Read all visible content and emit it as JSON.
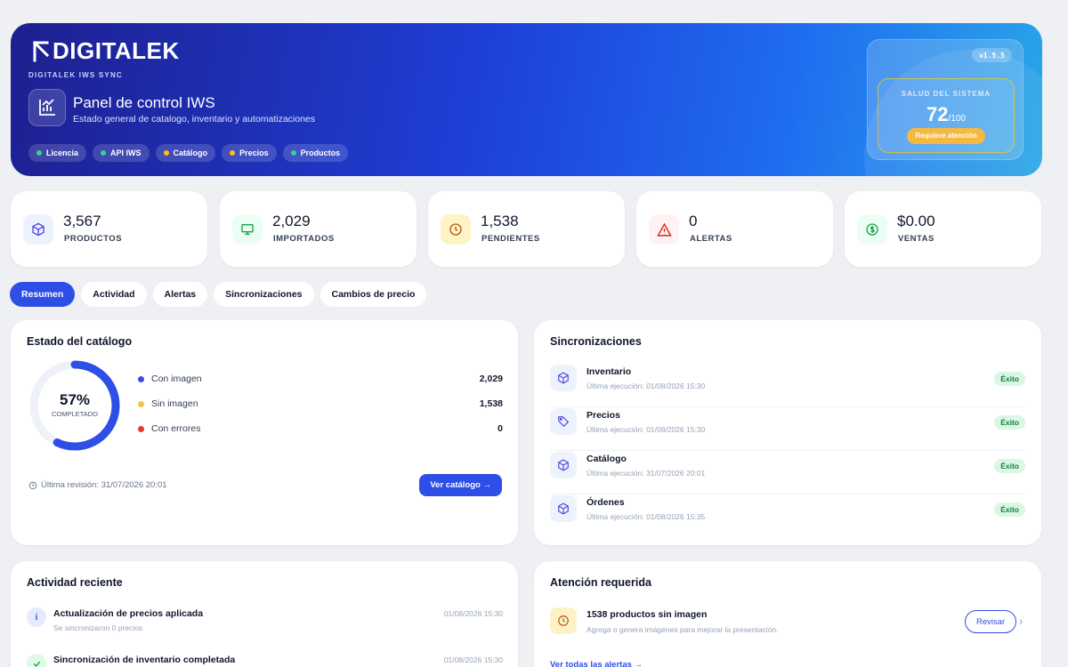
{
  "hero": {
    "logo_text": "DIGITALEK",
    "subtitle_brand": "DIGITALEK IWS SYNC",
    "title": "Panel de control IWS",
    "description": "Estado general de catalogo, inventario y automatizaciones",
    "chips": [
      {
        "label": "Licencia",
        "status_color": "#34d399"
      },
      {
        "label": "API IWS",
        "status_color": "#34d399"
      },
      {
        "label": "Catálogo",
        "status_color": "#fbbf24"
      },
      {
        "label": "Precios",
        "status_color": "#fbbf24"
      },
      {
        "label": "Productos",
        "status_color": "#34d399"
      }
    ],
    "version": "v1.5.5",
    "health": {
      "label": "SALUD DEL SISTEMA",
      "score": "72",
      "max": "/100",
      "badge": "Requiere atención"
    }
  },
  "stats": [
    {
      "value": "3,567",
      "label": "PRODUCTOS",
      "icon": "box-icon",
      "color": "#4f46e5",
      "bg": "#eef2ff"
    },
    {
      "value": "2,029",
      "label": "IMPORTADOS",
      "icon": "monitor-icon",
      "color": "#16a34a",
      "bg": "#ecfdf3"
    },
    {
      "value": "1,538",
      "label": "PENDIENTES",
      "icon": "clock-icon",
      "color": "#b45309",
      "bg": "#fef3c7"
    },
    {
      "value": "0",
      "label": "ALERTAS",
      "icon": "warning-icon",
      "color": "#dc2626",
      "bg": "#fef2f2"
    },
    {
      "value": "$0.00",
      "label": "VENTAS",
      "icon": "dollar-icon",
      "color": "#16a34a",
      "bg": "#ecfdf3"
    }
  ],
  "tabs": [
    "Resumen",
    "Actividad",
    "Alertas",
    "Sincronizaciones",
    "Cambios de precio"
  ],
  "catalog": {
    "title": "Estado del catálogo",
    "percent": "57%",
    "percent_value": 57,
    "percent_label": "COMPLETADO",
    "legend": [
      {
        "label": "Con imagen",
        "value": "2,029",
        "color": "#3b4fe4"
      },
      {
        "label": "Sin imagen",
        "value": "1,538",
        "color": "#f2c14e"
      },
      {
        "label": "Con errores",
        "value": "0",
        "color": "#dc3c3c"
      }
    ],
    "review": "Última revisión: 31/07/2026 20:01",
    "button": "Ver catálogo →"
  },
  "syncs": {
    "title": "Sincronizaciones",
    "items": [
      {
        "name": "Inventario",
        "time": "Última ejecución: 01/08/2026 15:30",
        "status": "Éxito",
        "icon": "box-icon"
      },
      {
        "name": "Precios",
        "time": "Última ejecución: 01/08/2026 15:30",
        "status": "Éxito",
        "icon": "tag-icon"
      },
      {
        "name": "Catálogo",
        "time": "Última ejecución: 31/07/2026 20:01",
        "status": "Éxito",
        "icon": "box-icon"
      },
      {
        "name": "Órdenes",
        "time": "Última ejecución: 01/08/2026 15:35",
        "status": "Éxito",
        "icon": "box-icon"
      }
    ]
  },
  "activity": {
    "title": "Actividad reciente",
    "items": [
      {
        "title": "Actualización de precios aplicada",
        "sub": "Se sincronizaron 0 precios",
        "time": "01/08/2026 15:30",
        "icon": "info-icon"
      },
      {
        "title": "Sincronización de inventario completada",
        "sub": "",
        "time": "01/08/2026 15:30",
        "icon": "check-icon"
      }
    ]
  },
  "attention": {
    "title": "Atención requerida",
    "item_title": "1538 productos sin imagen",
    "item_sub": "Agrega o genera imágenes para mejorar la presentación.",
    "button": "Revisar",
    "see_all": "Ver todas las alertas →"
  }
}
